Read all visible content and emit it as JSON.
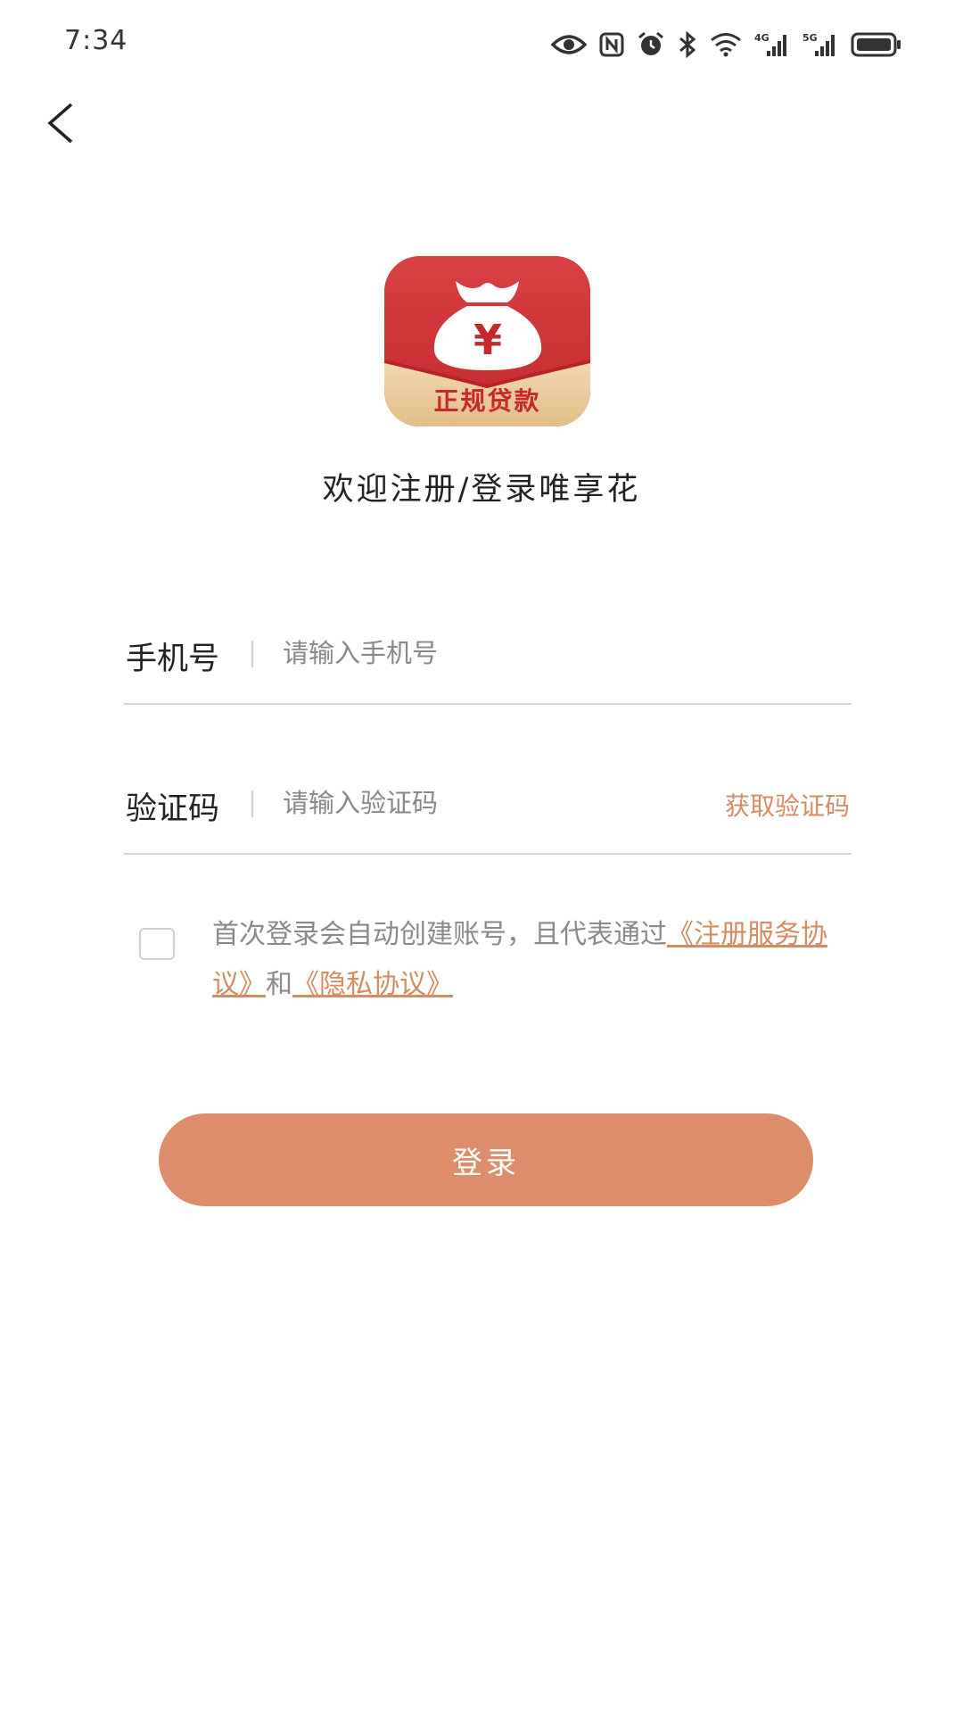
{
  "status_bar": {
    "time": "7:34",
    "icons": [
      "eye-icon",
      "nfc-icon",
      "alarm-icon",
      "bluetooth-icon",
      "wifi-icon",
      "signal-4g-icon",
      "signal-5g-icon",
      "battery-icon"
    ],
    "network_4g": "4G",
    "network_5g": "5G"
  },
  "nav": {
    "back_icon": "chevron-left-icon"
  },
  "logo": {
    "text": "正规贷款",
    "symbol": "¥",
    "colors": {
      "red": "#d0363a",
      "gold": "#e8c896"
    }
  },
  "welcome_text": "欢迎注册/登录唯享花",
  "form": {
    "phone": {
      "label": "手机号",
      "placeholder": "请输入手机号",
      "value": ""
    },
    "code": {
      "label": "验证码",
      "placeholder": "请输入验证码",
      "value": "",
      "get_code_label": "获取验证码"
    }
  },
  "agreement": {
    "checked": false,
    "prefix": "首次登录会自动创建账号，且代表通过",
    "link1": "《注册服务协议》",
    "connector": "和",
    "link2": "《隐私协议》"
  },
  "login_button": {
    "label": "登录"
  },
  "colors": {
    "accent": "#dd8d6b",
    "link": "#d68b63",
    "divider": "#d5d5d5"
  }
}
